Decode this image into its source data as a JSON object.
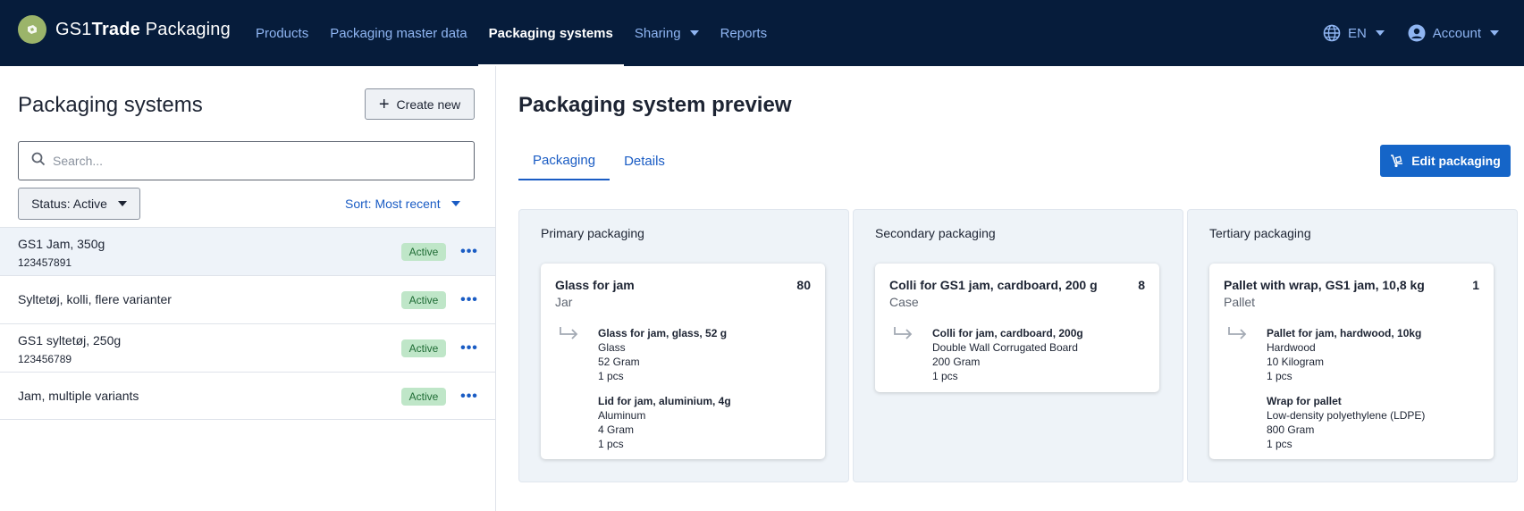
{
  "header": {
    "brand_prefix": "GS1",
    "brand_bold": "Trade",
    "brand_suffix": " Packaging",
    "nav": [
      "Products",
      "Packaging master data",
      "Packaging systems",
      "Sharing",
      "Reports"
    ],
    "active_nav": "Packaging systems",
    "language": "EN",
    "account": "Account",
    "colors": {
      "background": "#061c3b",
      "link": "#8fb5f2",
      "active": "#ffffff"
    }
  },
  "left": {
    "title": "Packaging systems",
    "create_label": "Create new",
    "search_placeholder": "Search...",
    "status_label": "Status: Active",
    "sort_label": "Sort: Most recent",
    "items": [
      {
        "title": "GS1 Jam, 350g",
        "sub": "123457891",
        "status": "Active"
      },
      {
        "title": "Syltetøj, kolli, flere varianter",
        "sub": "",
        "status": "Active"
      },
      {
        "title": "GS1 syltetøj, 250g",
        "sub": "123456789",
        "status": "Active"
      },
      {
        "title": "Jam, multiple variants",
        "sub": "",
        "status": "Active"
      }
    ],
    "more_label": "•••"
  },
  "right": {
    "title": "Packaging system preview",
    "tabs": [
      "Packaging",
      "Details"
    ],
    "edit_label": "Edit packaging",
    "columns": [
      {
        "title": "Primary packaging",
        "card": {
          "name": "Glass for jam",
          "qty": "80",
          "type": "Jar",
          "materials": [
            {
              "name": "Glass for jam, glass, 52 g",
              "material": "Glass",
              "weight": "52 Gram",
              "count": "1 pcs"
            },
            {
              "name": "Lid for jam, aluminium, 4g",
              "material": "Aluminum",
              "weight": "4 Gram",
              "count": "1 pcs"
            }
          ]
        }
      },
      {
        "title": "Secondary packaging",
        "card": {
          "name": "Colli for GS1 jam, cardboard, 200 g",
          "qty": "8",
          "type": "Case",
          "materials": [
            {
              "name": "Colli for jam, cardboard, 200g",
              "material": "Double Wall Corrugated Board",
              "weight": "200 Gram",
              "count": "1 pcs"
            }
          ]
        }
      },
      {
        "title": "Tertiary packaging",
        "card": {
          "name": "Pallet with wrap, GS1 jam, 10,8 kg",
          "qty": "1",
          "type": "Pallet",
          "materials": [
            {
              "name": "Pallet for jam, hardwood, 10kg",
              "material": "Hardwood",
              "weight": "10 Kilogram",
              "count": "1 pcs"
            },
            {
              "name": "Wrap for pallet",
              "material": "Low-density polyethylene (LDPE)",
              "weight": "800 Gram",
              "count": "1 pcs"
            }
          ]
        }
      }
    ],
    "colors": {
      "accent": "#1565c8",
      "badge_bg": "#bfe6c8",
      "badge_text": "#1e6b34"
    }
  }
}
